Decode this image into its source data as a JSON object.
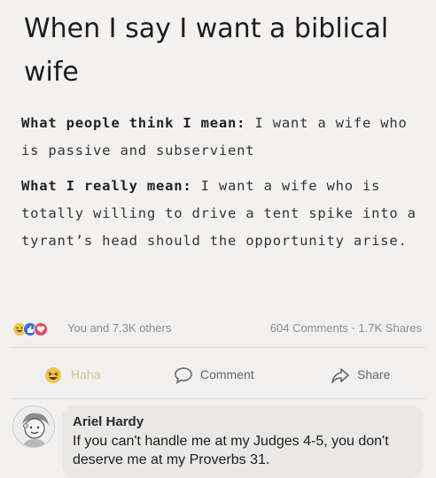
{
  "post": {
    "heading": "When I say I want a biblical wife",
    "para1_label": "What people think I mean:",
    "para1_text": "I want a wife who is passive and subservient",
    "para2_label": "What I really mean:",
    "para2_text": "I want a wife who is totally willing to drive a tent spike into a tyrant’s head should the opportunity arise."
  },
  "reactions": {
    "icons": [
      "haha-icon",
      "like-icon",
      "love-icon"
    ],
    "summary": "You and 7.3K others",
    "counts": "604 Comments · 1.7K Shares"
  },
  "actions": {
    "haha_label": "Haha",
    "comment_label": "Comment",
    "share_label": "Share"
  },
  "comment": {
    "author": "Ariel Hardy",
    "text": "If you can't handle me at my Judges 4-5, you don't deserve me at my Proverbs 31."
  },
  "colors": {
    "haha": "#f0c64a",
    "like": "#3b6fd6",
    "love": "#e4455d",
    "muted_text": "#8b8d90"
  }
}
